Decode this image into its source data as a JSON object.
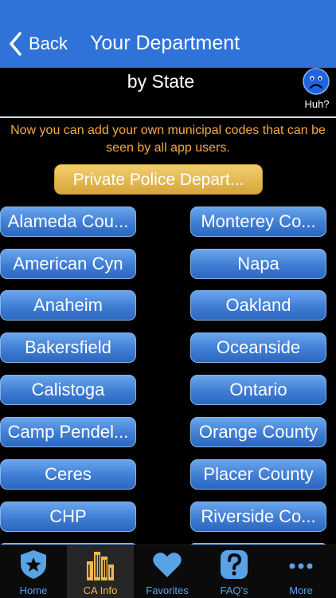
{
  "navbar": {
    "back_label": "Back",
    "title": "Your Department"
  },
  "subheader": {
    "title": "by State",
    "huh_label": "Huh?",
    "huh_icon": "sad-face-icon"
  },
  "notice": "Now you can add your own municipal codes that can be seen by all app users.",
  "private_button": "Private Police Depart...",
  "departments_left": [
    "Alameda Cou...",
    "American Cyn",
    "Anaheim",
    "Bakersfield",
    "Calistoga",
    "Camp Pendel...",
    "Ceres",
    "CHP"
  ],
  "departments_right": [
    "Monterey Co...",
    "Napa",
    "Oakland",
    "Oceanside",
    "Ontario",
    "Orange County",
    "Placer County",
    "Riverside Co..."
  ],
  "tabs": [
    {
      "label": "Home",
      "icon": "police-badge-icon"
    },
    {
      "label": "CA Info",
      "icon": "city-buildings-icon",
      "active": true
    },
    {
      "label": "Favorites",
      "icon": "heart-icon"
    },
    {
      "label": "FAQ's",
      "icon": "question-mark-icon"
    },
    {
      "label": "More",
      "icon": "more-dots-icon"
    }
  ],
  "colors": {
    "navbar": "#2f73d9",
    "notice": "#f2a94a",
    "accent": "#5aa2e6",
    "active_tab": "#f0b94a"
  }
}
